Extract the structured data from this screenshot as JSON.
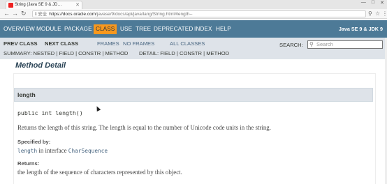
{
  "browser": {
    "tab_title": "String (Java SE 9 & JD…",
    "url_secure": "ℹ 安全",
    "url_host": "https://docs.oracle.com",
    "url_path": "/javase/9/docs/api/java/lang/String.html#length--",
    "icons": [
      "back-icon",
      "forward-icon",
      "reload-icon",
      "zoom-icon",
      "star-icon",
      "menu-icon"
    ]
  },
  "topnav": {
    "items": [
      "OVERVIEW",
      "MODULE",
      "PACKAGE",
      "CLASS",
      "USE",
      "TREE",
      "DEPRECATED",
      "INDEX",
      "HELP"
    ],
    "active": "CLASS",
    "about": "Java SE 9 & JDK 9"
  },
  "subnav": {
    "prev_class": "PREV CLASS",
    "next_class": "NEXT CLASS",
    "frames": "FRAMES",
    "no_frames": "NO FRAMES",
    "all_classes": "ALL CLASSES",
    "search_label": "SEARCH:",
    "search_placeholder": "Search",
    "summary": "SUMMARY: NESTED | FIELD | CONSTR | METHOD",
    "detail": "DETAIL: FIELD | CONSTR | METHOD"
  },
  "content": {
    "section_title": "Method Detail",
    "method_name": "length",
    "signature": "public int length()",
    "description": "Returns the length of this string. The length is equal to the number of Unicode code units in the string.",
    "specified_by_label": "Specified by:",
    "specified_method": "length",
    "specified_in": " in interface ",
    "specified_interface": "CharSequence",
    "returns_label": "Returns:",
    "returns_text": "the length of the sequence of characters represented by this object."
  },
  "colors": {
    "topnav_bg": "#4d7a97",
    "active_tab": "#f8981d",
    "subnav_bg": "#dee3e9",
    "link": "#4a6782"
  }
}
